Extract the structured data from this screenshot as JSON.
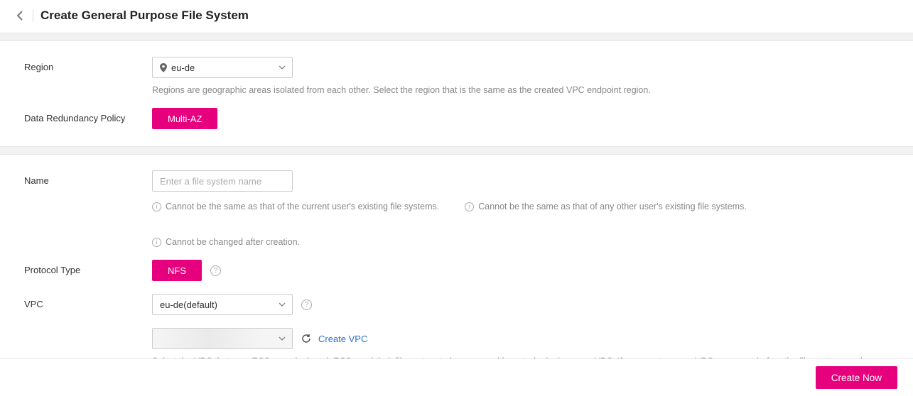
{
  "header": {
    "title": "Create General Purpose File System"
  },
  "region": {
    "label": "Region",
    "value": "eu-de",
    "helper": "Regions are geographic areas isolated from each other. Select the region that is the same as the created VPC endpoint region."
  },
  "redundancy": {
    "label": "Data Redundancy Policy",
    "value": "Multi-AZ"
  },
  "name": {
    "label": "Name",
    "placeholder": "Enter a file system name",
    "value": "",
    "hints": [
      "Cannot be the same as that of the current user's existing file systems.",
      "Cannot be the same as that of any other user's existing file systems.",
      "Cannot be changed after creation."
    ]
  },
  "protocol": {
    "label": "Protocol Type",
    "value": "NFS"
  },
  "vpc": {
    "label": "VPC",
    "value": "eu-de(default)",
    "subnet_value": "",
    "create_link": "Create VPC",
    "helper": "Select the VPC that your ECSs are deployed. ECSs and their file system to be accessed have to be in the same VPC. If you create a new VPC, you must before the file system can be used."
  },
  "footer": {
    "submit": "Create Now"
  }
}
